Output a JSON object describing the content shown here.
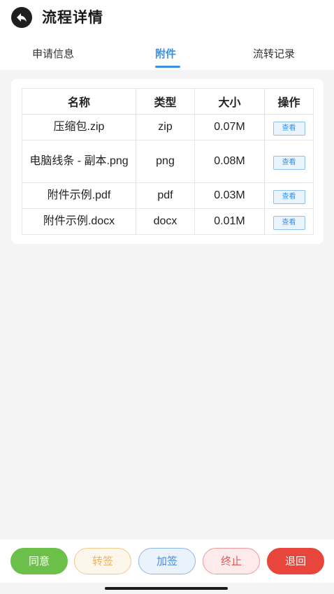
{
  "header": {
    "title": "流程详情",
    "back_icon": "back-arrow-icon"
  },
  "tabs": [
    {
      "label": "申请信息"
    },
    {
      "label": "附件"
    },
    {
      "label": "流转记录"
    }
  ],
  "active_tab": "附件",
  "table": {
    "columns": [
      "名称",
      "类型",
      "大小",
      "操作"
    ],
    "rows": [
      {
        "name": "压缩包.zip",
        "type": "zip",
        "size": "0.07M",
        "action": "查看"
      },
      {
        "name": "电脑线条 - 副本.png",
        "type": "png",
        "size": "0.08M",
        "action": "查看"
      },
      {
        "name": "附件示例.pdf",
        "type": "pdf",
        "size": "0.03M",
        "action": "查看"
      },
      {
        "name": "附件示例.docx",
        "type": "docx",
        "size": "0.01M",
        "action": "查看"
      }
    ]
  },
  "actions": {
    "agree": "同意",
    "transfer": "转签",
    "add_sign": "加签",
    "stop": "终止",
    "return": "退回"
  },
  "colors": {
    "accent": "#3d8fe0",
    "agree": "#6cc04a",
    "return": "#e8453c"
  }
}
